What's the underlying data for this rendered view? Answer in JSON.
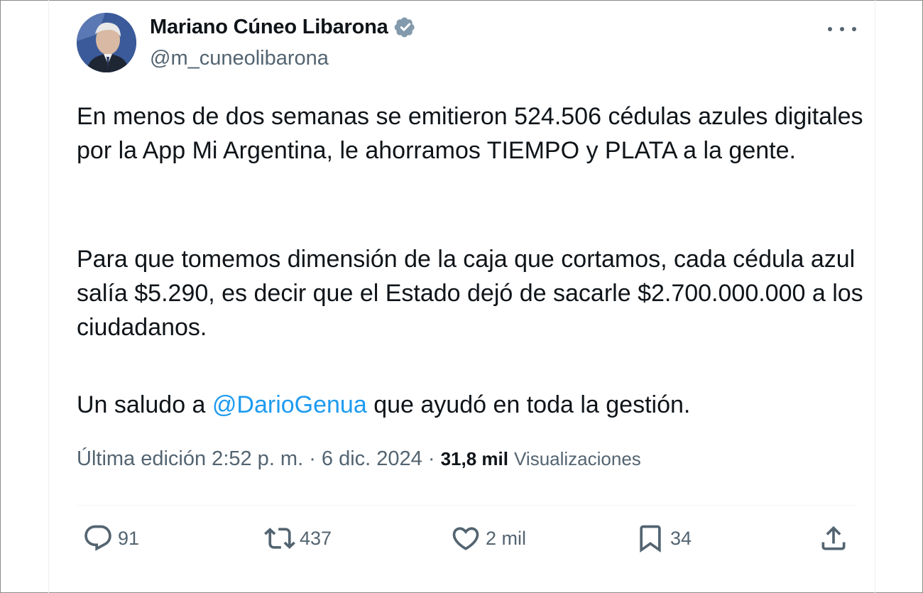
{
  "tweet": {
    "author_name": "Mariano Cúneo Libarona",
    "author_handle": "@m_cuneolibarona",
    "verified": true,
    "paragraph1": "En menos de dos semanas se emitieron 524.506 cédulas azules digitales por la App Mi Argentina, le ahorramos TIEMPO y PLATA a la gente.",
    "paragraph2": "Para que tomemos dimensión de la caja que cortamos, cada cédula azul salía $5.290, es decir que el Estado dejó de sacarle $2.700.000.000 a los ciudadanos.",
    "paragraph3_prefix": "Un saludo a ",
    "paragraph3_mention": "@DarioGenua",
    "paragraph3_suffix": " que ayudó en toda la gestión.",
    "meta_edit": "Última edición 2:52 p. m. · 6 dic. 2024 · ",
    "views_count": "31,8 mil",
    "views_label": "Visualizaciones"
  },
  "actions": {
    "replies": "91",
    "retweets": "437",
    "likes": "2 mil",
    "bookmarks": "34"
  },
  "icons": {
    "verified": "verified-badge-icon",
    "more": "more-options-icon",
    "reply": "reply-bubble-icon",
    "retweet": "retweet-icon",
    "like": "heart-icon",
    "bookmark": "bookmark-icon",
    "share": "share-icon"
  },
  "colors": {
    "text": "#0f1419",
    "secondary": "#536471",
    "link": "#1d9bf0",
    "verified_badge": "#829aab"
  }
}
